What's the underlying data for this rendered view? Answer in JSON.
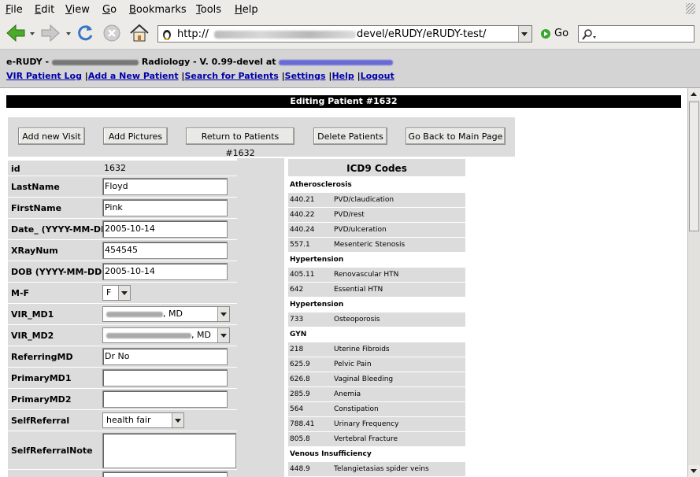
{
  "menu": [
    "File",
    "Edit",
    "View",
    "Go",
    "Bookmarks",
    "Tools",
    "Help"
  ],
  "menu_mnemonics": [
    "F",
    "E",
    "V",
    "G",
    "B",
    "T",
    "H"
  ],
  "toolbar": {
    "url_prefix": "http://",
    "url_suffix": "devel/eRUDY/eRUDY-test/",
    "go_label": "Go"
  },
  "app": {
    "title_prefix": "e-RUDY -",
    "title_middle": "Radiology - V. 0.99-devel at",
    "nav": [
      "VIR Patient Log",
      "Add a New Patient",
      "Search for Patients",
      "Settings",
      "Help",
      "Logout"
    ]
  },
  "edit_heading": "Editing Patient #1632",
  "buttons": [
    "Add new Visit",
    "Add Pictures",
    "Return to Patients #1632",
    "Delete Patients",
    "Go Back to Main Page"
  ],
  "form": {
    "id_label": "id",
    "id_value": "1632",
    "lastname_label": "LastName",
    "lastname_value": "Floyd",
    "firstname_label": "FirstName",
    "firstname_value": "Pink",
    "date_label": "Date_ (YYYY-MM-DD)",
    "date_value": "2005-10-14",
    "xray_label": "XRayNum",
    "xray_value": "454545",
    "dob_label": "DOB (YYYY-MM-DD)",
    "dob_value": "2005-10-14",
    "mf_label": "M-F",
    "mf_value": "F",
    "md1_label": "VIR_MD1",
    "md1_value": ", MD",
    "md2_label": "VIR_MD2",
    "md2_value": ", MD",
    "refmd_label": "ReferringMD",
    "refmd_value": "Dr No",
    "pmd1_label": "PrimaryMD1",
    "pmd1_value": "",
    "pmd2_label": "PrimaryMD2",
    "pmd2_value": "",
    "selfref_label": "SelfReferral",
    "selfref_value": "health fair",
    "selfnote_label": "SelfReferralNote",
    "selfnote_value": ""
  },
  "icd": {
    "title": "ICD9 Codes",
    "rows": [
      {
        "cat": "Atherosclerosis"
      },
      {
        "code": "440.21",
        "desc": "PVD/claudication"
      },
      {
        "code": "440.22",
        "desc": "PVD/rest"
      },
      {
        "code": "440.24",
        "desc": "PVD/ulceration"
      },
      {
        "code": "557.1",
        "desc": "Mesenteric Stenosis"
      },
      {
        "cat": "Hypertension"
      },
      {
        "code": "405.11",
        "desc": "Renovascular HTN"
      },
      {
        "code": "642",
        "desc": "Essential HTN"
      },
      {
        "cat": "Hypertension"
      },
      {
        "code": "733",
        "desc": "Osteoporosis"
      },
      {
        "cat": "GYN"
      },
      {
        "code": "218",
        "desc": "Uterine Fibroids"
      },
      {
        "code": "625.9",
        "desc": "Pelvic Pain"
      },
      {
        "code": "626.8",
        "desc": "Vaginal Bleeding"
      },
      {
        "code": "285.9",
        "desc": "Anemia"
      },
      {
        "code": "564",
        "desc": "Constipation"
      },
      {
        "code": "788.41",
        "desc": "Urinary Frequency"
      },
      {
        "code": "805.8",
        "desc": "Vertebral Fracture"
      },
      {
        "cat": "Venous Insufficiency"
      },
      {
        "code": "448.9",
        "desc": "Telangietasias spider veins"
      }
    ]
  },
  "colors": {
    "link": "#0000aa",
    "header_bg": "#d4d4d4",
    "edit_bar": "#000000",
    "panel": "#dcdcdc"
  }
}
